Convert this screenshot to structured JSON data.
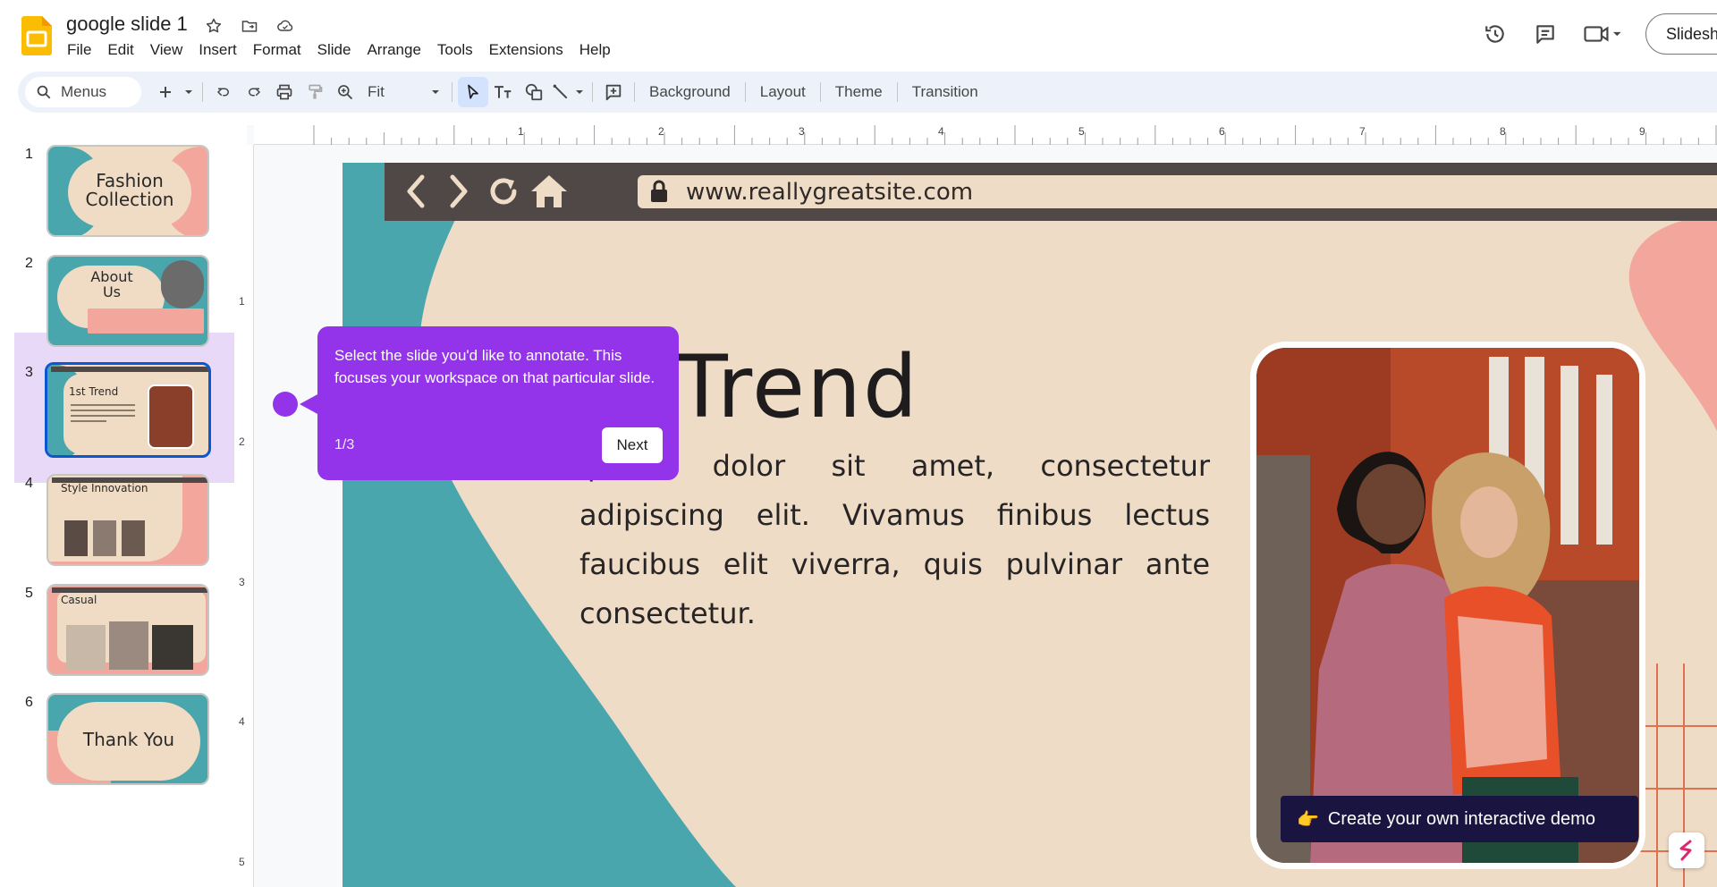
{
  "header": {
    "doc_title": "google slide 1",
    "menu": [
      "File",
      "Insert",
      "Format",
      "Slide",
      "Arrange",
      "Tools",
      "Extensions",
      "Help"
    ],
    "menu_view": "View",
    "menu_edit": "Edit",
    "slideshow_label": "Slidesh"
  },
  "toolbar": {
    "search_label": "Menus",
    "zoom_value": "Fit",
    "background_label": "Background",
    "layout_label": "Layout",
    "theme_label": "Theme",
    "transition_label": "Transition"
  },
  "filmstrip": {
    "slides": [
      {
        "number": "1",
        "title": "Fashion Collection",
        "title_l1": "Fashion",
        "title_l2": "Collection"
      },
      {
        "number": "2",
        "title_l1": "About",
        "title_l2": "Us"
      },
      {
        "number": "3",
        "title": "1st Trend"
      },
      {
        "number": "4",
        "title": "Style Innovation"
      },
      {
        "number": "5",
        "title": "Casual"
      },
      {
        "number": "6",
        "title": "Thank You"
      }
    ]
  },
  "ruler": {
    "h": [
      "1",
      "2",
      "3",
      "4",
      "5",
      "6",
      "7",
      "8",
      "9"
    ],
    "v": [
      "1",
      "2",
      "3",
      "4",
      "5"
    ]
  },
  "slide": {
    "url": "www.reallygreatsite.com",
    "title": "t Trend",
    "body": "ipsum dolor sit amet, consectetur adipiscing elit. Vivamus finibus lectus faucibus elit viverra, quis pulvinar ante consectetur."
  },
  "tour": {
    "text": "Select the slide you'd like to annotate. This focuses your workspace on that particular slide.",
    "step": "1/3",
    "next_label": "Next"
  },
  "demo_banner": {
    "emoji": "👉",
    "label": "Create your own interactive demo"
  },
  "colors": {
    "tour_purple": "#9333ea",
    "slide_cream": "#efdcc6",
    "slide_teal": "#4aa6ad",
    "slide_pink": "#f3a69b",
    "selection_blue": "#0b57d0"
  }
}
